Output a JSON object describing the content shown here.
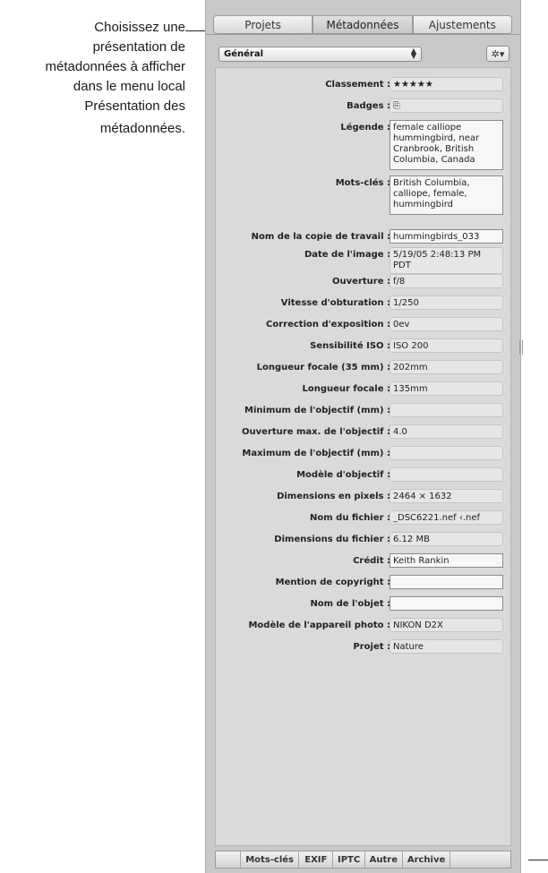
{
  "callout": {
    "lines": [
      "Choisissez une",
      "présentation de",
      "métadonnées à afficher",
      "dans le menu local",
      "Présentation des",
      "métadonnées."
    ]
  },
  "tabs": [
    {
      "label": "Projets",
      "active": false
    },
    {
      "label": "Métadonnées",
      "active": true
    },
    {
      "label": "Ajustements",
      "active": false
    }
  ],
  "presets": {
    "selected": "Général",
    "arrows_icon": "up-down-arrows-icon"
  },
  "gear": {
    "icon": "gear-icon",
    "glyph": "✲▾"
  },
  "fields": [
    {
      "label": "Classement :",
      "value": "★★★★★",
      "editable": false
    },
    {
      "label": "Badges :",
      "value": "⎘",
      "editable": false
    },
    {
      "label": "Légende :",
      "value": "female calliope hummingbird, near Cranbrook, British Columbia, Canada",
      "editable": true
    },
    {
      "label": "Mots-clés :",
      "value": "British Columbia, calliope, female, hummingbird",
      "editable": true
    },
    {
      "label": "Nom de la copie de travail :",
      "value": "hummingbirds_033",
      "editable": true
    },
    {
      "label": "Date de l'image :",
      "value": "5/19/05 2:48:13 PM PDT",
      "editable": false
    },
    {
      "label": "Ouverture :",
      "value": "f/8",
      "editable": false
    },
    {
      "label": "Vitesse d'obturation :",
      "value": "1/250",
      "editable": false
    },
    {
      "label": "Correction d'exposition :",
      "value": "0ev",
      "editable": false
    },
    {
      "label": "Sensibilité ISO :",
      "value": "ISO 200",
      "editable": false
    },
    {
      "label": "Longueur focale (35 mm) :",
      "value": "202mm",
      "editable": false
    },
    {
      "label": "Longueur focale :",
      "value": "135mm",
      "editable": false
    },
    {
      "label": "Minimum de l'objectif (mm) :",
      "value": "",
      "editable": false
    },
    {
      "label": "Ouverture max. de l'objectif :",
      "value": "4.0",
      "editable": false
    },
    {
      "label": "Maximum de l'objectif (mm) :",
      "value": "",
      "editable": false
    },
    {
      "label": "Modèle d'objectif :",
      "value": "",
      "editable": false
    },
    {
      "label": "Dimensions en pixels :",
      "value": "2464 × 1632",
      "editable": false
    },
    {
      "label": "Nom du fichier :",
      "value": "_DSC6221.nef ‹.nef",
      "editable": false
    },
    {
      "label": "Dimensions du fichier :",
      "value": "6.12 MB",
      "editable": false
    },
    {
      "label": "Crédit :",
      "value": "Keith Rankin",
      "editable": true
    },
    {
      "label": "Mention de copyright :",
      "value": "",
      "editable": true
    },
    {
      "label": "Nom de l'objet :",
      "value": "",
      "editable": true
    },
    {
      "label": "Modèle de l'appareil photo :",
      "value": "NIKON D2X",
      "editable": false
    },
    {
      "label": "Projet :",
      "value": "Nature",
      "editable": false
    }
  ],
  "bottom_tabs": [
    "Mots-clés",
    "EXIF",
    "IPTC",
    "Autre",
    "Archive"
  ]
}
